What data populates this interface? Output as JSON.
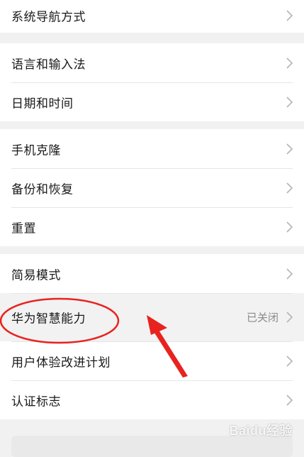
{
  "sections": [
    {
      "items": [
        {
          "label": "系统导航方式"
        }
      ]
    },
    {
      "items": [
        {
          "label": "语言和输入法"
        },
        {
          "label": "日期和时间"
        }
      ]
    },
    {
      "items": [
        {
          "label": "手机克隆"
        },
        {
          "label": "备份和恢复"
        },
        {
          "label": "重置"
        }
      ]
    },
    {
      "items": [
        {
          "label": "简易模式"
        },
        {
          "label": "华为智慧能力",
          "value": "已关闭"
        },
        {
          "label": "用户体验改进计划"
        },
        {
          "label": "认证标志"
        }
      ]
    }
  ],
  "watermark": "Baidu经验",
  "colors": {
    "annotation": "#e8231f",
    "background": "#f1f1f1",
    "card": "#ffffff"
  }
}
